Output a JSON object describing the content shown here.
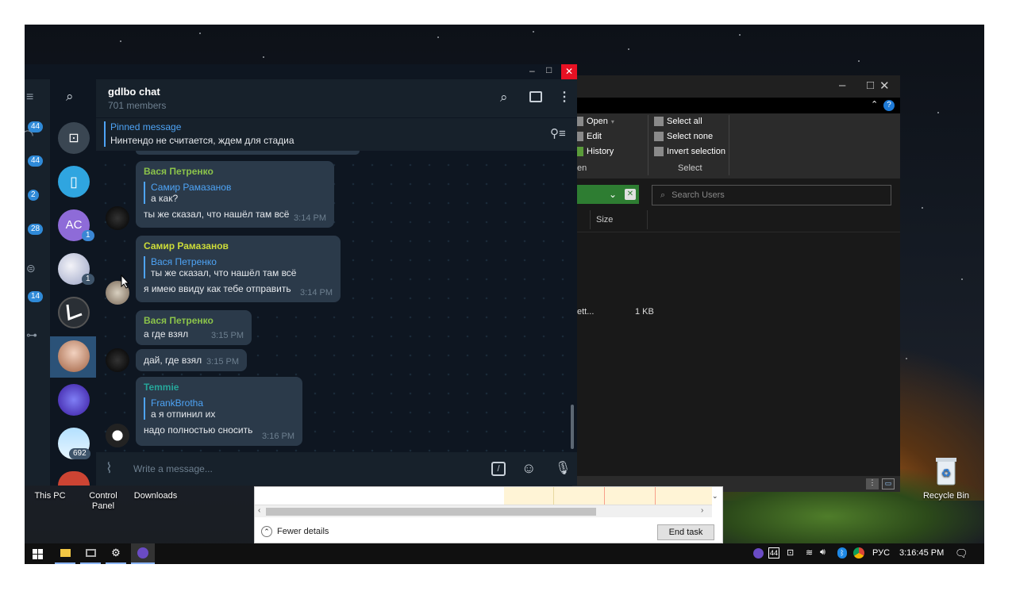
{
  "desktop": {
    "icons": [
      {
        "label": "This PC"
      },
      {
        "label": "Control\nPanel"
      },
      {
        "label": "Downloads"
      },
      {
        "label": "Recycle Bin"
      }
    ]
  },
  "telegram": {
    "window_controls": {
      "minimize": "–",
      "maximize": "□",
      "close": "✕"
    },
    "left_badges": [
      "44",
      "44",
      "2",
      "28",
      "14"
    ],
    "chat_list_badges": {
      "ac_initials": "AC",
      "ac_count": "1",
      "anime_count": "1",
      "bottom_count": "692"
    },
    "header": {
      "title": "gdlbo chat",
      "subtitle": "701 members"
    },
    "pinned": {
      "label": "Pinned message",
      "text": "Нинтендо не считается,  ждем для стадиа"
    },
    "messages": [
      {
        "name": "Вася Петренко",
        "name_color": "#8bc34a",
        "reply_name": "Самир Рамазанов",
        "reply_text": "а как?",
        "text": "ты же сказал, что нашёл там всё",
        "time": "3:14 PM"
      },
      {
        "name": "Самир Рамазанов",
        "name_color": "#cddc39",
        "reply_name": "Вася Петренко",
        "reply_text": "ты же сказал, что нашёл там всё",
        "text": "я имею ввиду как тебе отправить",
        "time": "3:14 PM"
      },
      {
        "name": "Вася Петренко",
        "name_color": "#8bc34a",
        "text": "а где взял",
        "time": "3:15 PM"
      },
      {
        "text": "дай, где взял",
        "time": "3:15 PM"
      },
      {
        "name": "Temmie",
        "name_color": "#26a69a",
        "reply_name": "FrankBrotha",
        "reply_text": "а я отпинил их",
        "text": "надо полностью сносить",
        "time": "3:16 PM"
      }
    ],
    "input": {
      "placeholder": "Write a message..."
    }
  },
  "explorer": {
    "ribbon": {
      "open": "Open",
      "edit": "Edit",
      "history": "History",
      "open_group": "en",
      "select_all": "Select all",
      "select_none": "Select none",
      "invert": "Invert selection",
      "select_group": "Select"
    },
    "search_placeholder": "Search Users",
    "columns": {
      "size": "Size"
    },
    "row": {
      "name": "ett...",
      "size": "1 KB"
    }
  },
  "taskmgr": {
    "fewer": "Fewer details",
    "end_task": "End task"
  },
  "taskbar": {
    "lang": "РУС",
    "time": "3:16:45 PM",
    "tray_num": "44"
  }
}
